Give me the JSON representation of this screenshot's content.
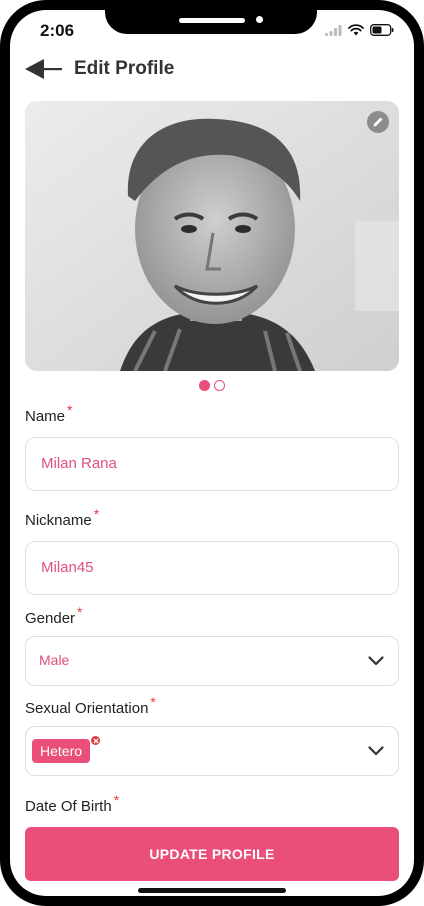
{
  "status_bar": {
    "time": "2:06"
  },
  "header": {
    "title": "Edit Profile"
  },
  "photos": {
    "count": 2,
    "active_index": 0
  },
  "form": {
    "name": {
      "label": "Name",
      "required_mark": "*",
      "value": "Milan Rana"
    },
    "nickname": {
      "label": "Nickname",
      "required_mark": "*",
      "value": "Milan45"
    },
    "gender": {
      "label": "Gender",
      "required_mark": "*",
      "value": "Male"
    },
    "sexual_orientation": {
      "label": "Sexual Orientation",
      "required_mark": "*",
      "tags": [
        "Hetero"
      ]
    },
    "date_of_birth": {
      "label": "Date Of Birth",
      "required_mark": "*"
    }
  },
  "submit": {
    "label": "UPDATE PROFILE"
  },
  "colors": {
    "accent": "#e94f78",
    "required": "#e63c3c",
    "value_text": "#e0517a"
  },
  "icons": [
    "back-arrow-icon",
    "edit-pencil-icon",
    "chevron-down-icon",
    "close-icon",
    "wifi-icon",
    "battery-icon",
    "signal-icon"
  ]
}
